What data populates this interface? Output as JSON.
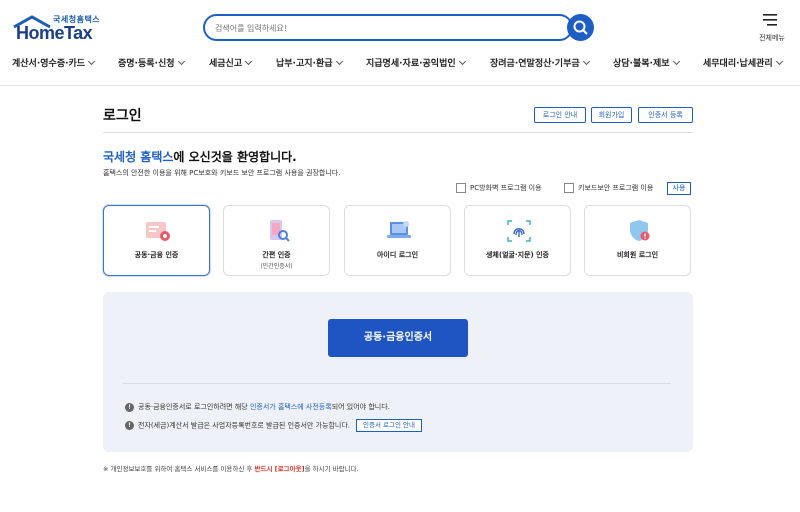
{
  "header": {
    "logo_sub": "국세청홈택스",
    "logo_main": "HomeTax",
    "search_placeholder": "검색어를 입력하세요!",
    "menu_label": "전체메뉴"
  },
  "nav": [
    "계산서·영수증·카드",
    "증명·등록·신청",
    "세금신고",
    "납부·고지·환급",
    "지급명세·자료·공익법인",
    "장려금·연말정산·기부금",
    "상담·불복·제보",
    "세무대리·납세관리"
  ],
  "page": {
    "title": "로그인",
    "top_buttons": [
      "로그인 안내",
      "회원가입",
      "인증서 등록"
    ]
  },
  "welcome": {
    "highlight": "국세청 홈택스",
    "rest": "에 오신것을 환영합니다.",
    "sub": "홈택스의 안전한 이용을 위해 PC보호와 키보드 보안 프로그램 사용을 권장합니다."
  },
  "security": {
    "firewall": "PC방화벽 프로그램 이용",
    "keyboard": "키보드보안 프로그램 이용",
    "use": "사용"
  },
  "login_methods": [
    {
      "label": "공동·금융 인증",
      "sub": "",
      "icon": "certificate-icon",
      "active": true
    },
    {
      "label": "간편 인증",
      "sub": "(민간인증서)",
      "icon": "phone-auth-icon",
      "active": false
    },
    {
      "label": "아이디 로그인",
      "sub": "",
      "icon": "laptop-icon",
      "active": false
    },
    {
      "label": "생체(얼굴·지문) 인증",
      "sub": "",
      "icon": "fingerprint-icon",
      "active": false
    },
    {
      "label": "비회원 로그인",
      "sub": "",
      "icon": "shield-icon",
      "active": false
    }
  ],
  "panel": {
    "main_button": "공동·금융인증서",
    "note1_a": "공동·금융인증서로 로그인하려면 해당 ",
    "note1_b": "인증서가 홈택스에 사전등록",
    "note1_c": "되어 있어야 합니다.",
    "note2": "전자(세금)계산서 발급은 사업자등록번호로 발급된 인증서만 가능합니다.",
    "guide_button": "인증서 로그인 안내"
  },
  "footer": {
    "a": "※ 개인정보보호를 위하여 홈택스 서비스를 이용하신 후 ",
    "b": "반드시 [로그아웃]",
    "c": "을 하시기 바랍니다."
  },
  "colors": {
    "brand": "#1f5fc4",
    "navy": "#1a3f87",
    "panel_bg": "#eef2f8",
    "warning": "#d93025"
  }
}
